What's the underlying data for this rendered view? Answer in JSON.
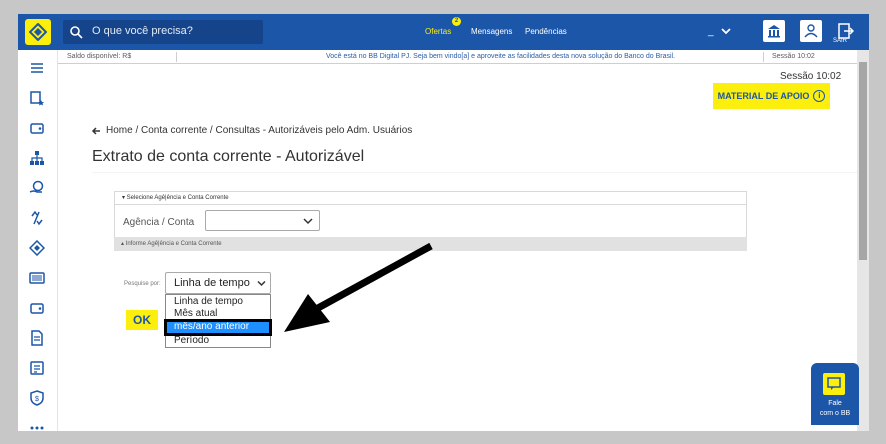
{
  "colors": {
    "brand_blue": "#1c56a8",
    "brand_yellow": "#fcef0e",
    "selected_blue": "#1e8fff"
  },
  "header": {
    "search_placeholder": "O que você precisa?",
    "nav": {
      "ofertas": "Ofertas",
      "ofertas_badge": "2",
      "mensagens": "Mensagens",
      "pendencias": "Pendências"
    },
    "account_underscore": "_",
    "sair_label": "SAIR"
  },
  "infobar": {
    "saldo": "Saldo disponível: R$",
    "welcome": "Você está no BB Digital PJ. Seja bem vindo[a] e aproveite as facilidades desta nova solução do Banco do Brasil.",
    "sessao": "Sessão 10:02"
  },
  "sidebar": {
    "icons": [
      "menu-icon",
      "star-document-icon",
      "wallet-icon",
      "org-chart-icon",
      "coin-hand-icon",
      "transfer-icon",
      "diamond-icon",
      "barcode-icon",
      "wallet2-icon",
      "receipt-icon",
      "invoice-icon",
      "shield-money-icon",
      "more-icon"
    ]
  },
  "main": {
    "sessao": "Sessão 10:02",
    "material_label": "MATERIAL DE APOIO",
    "breadcrumb": "Home / Conta corrente / Consultas - Autorizáveis pelo Adm. Usuários",
    "title": "Extrato de conta corrente - Autorizável",
    "section1_header": "▾ Selecione Agê|ência e Conta Corrente",
    "agencia_label": "Agência / Conta",
    "section2_header": "▴ Informe Agê|ência e Conta Corrente",
    "pesquise_label": "Pesquise por:",
    "tempo_value": "Linha de tempo",
    "options": [
      "Linha de tempo",
      "Mês atual",
      "mês/ano anterior",
      "Período"
    ],
    "ok_label": "OK"
  },
  "fale": {
    "line1": "Fale",
    "line2": "com o BB"
  }
}
